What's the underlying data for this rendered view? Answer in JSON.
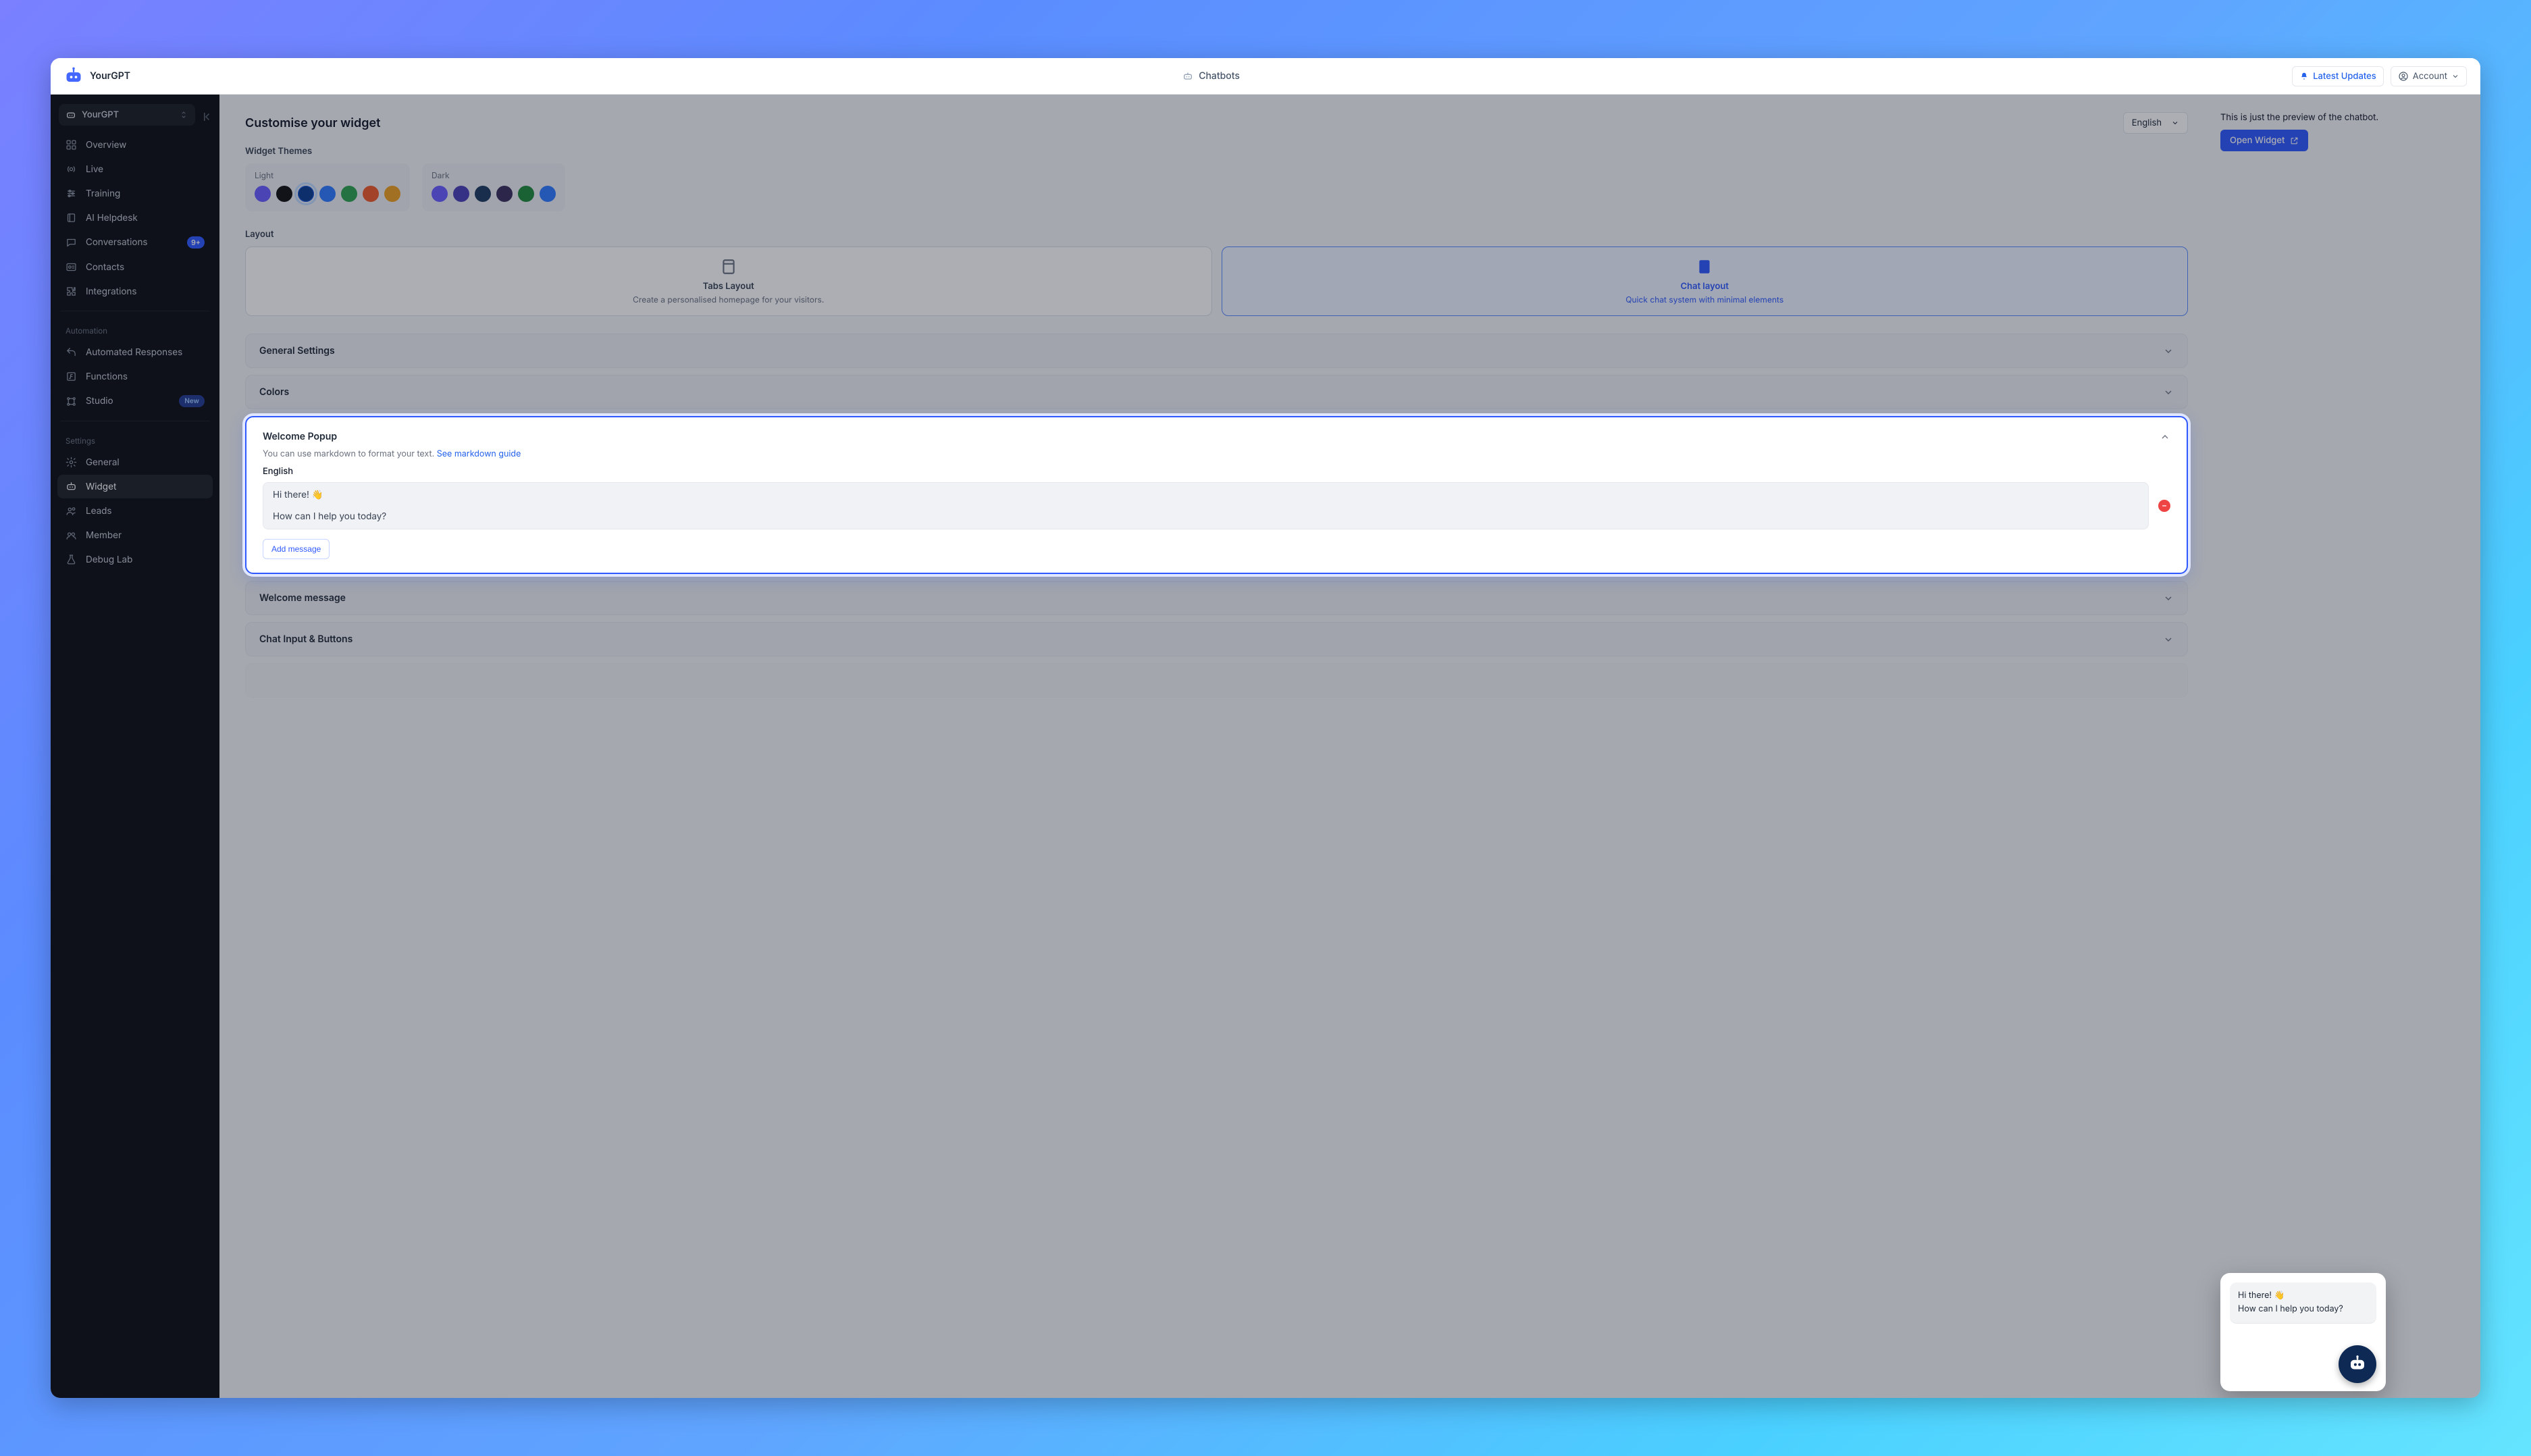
{
  "brand": {
    "name": "YourGPT"
  },
  "topbar": {
    "center": "Chatbots",
    "latest_updates": "Latest Updates",
    "account": "Account"
  },
  "sidebar": {
    "workspace": "YourGPT",
    "primary": [
      {
        "label": "Overview",
        "icon": "dashboard-icon"
      },
      {
        "label": "Live",
        "icon": "live-icon"
      },
      {
        "label": "Training",
        "icon": "sliders-icon"
      },
      {
        "label": "AI Helpdesk",
        "icon": "book-icon"
      },
      {
        "label": "Conversations",
        "icon": "chat-icon",
        "badge_count": "9+"
      },
      {
        "label": "Contacts",
        "icon": "user-card-icon"
      },
      {
        "label": "Integrations",
        "icon": "puzzle-icon"
      }
    ],
    "section_automation": "Automation",
    "automation": [
      {
        "label": "Automated Responses",
        "icon": "reply-icon"
      },
      {
        "label": "Functions",
        "icon": "function-icon"
      },
      {
        "label": "Studio",
        "icon": "studio-icon",
        "badge_new": "New"
      }
    ],
    "section_settings": "Settings",
    "settings": [
      {
        "label": "General",
        "icon": "gear-icon"
      },
      {
        "label": "Widget",
        "icon": "bot-icon",
        "active": true
      },
      {
        "label": "Leads",
        "icon": "users-icon"
      },
      {
        "label": "Member",
        "icon": "members-icon"
      },
      {
        "label": "Debug Lab",
        "icon": "flask-icon"
      }
    ]
  },
  "page": {
    "title": "Customise your widget",
    "language": "English",
    "themes_label": "Widget Themes",
    "light_label": "Light",
    "dark_label": "Dark",
    "light_swatches": [
      "#6a5cff",
      "#111111",
      "#0b3d91",
      "#2f7cff",
      "#2ea44f",
      "#ef5a2a",
      "#f0a020"
    ],
    "light_selected_index": 2,
    "dark_swatches": [
      "#6a5cff",
      "#4a3fb5",
      "#1e3a60",
      "#3a2f5c",
      "#1f8a3b",
      "#2f7cff"
    ],
    "layout_label": "Layout",
    "layout_tabs": {
      "title": "Tabs Layout",
      "desc": "Create a personalised homepage for your visitors."
    },
    "layout_chat": {
      "title": "Chat layout",
      "desc": "Quick chat system with minimal elements"
    },
    "accordions": {
      "general": "General Settings",
      "colors": "Colors",
      "welcome_popup": "Welcome Popup",
      "welcome_message": "Welcome message",
      "chat_input": "Chat Input & Buttons"
    },
    "welcome_popup": {
      "help": "You can use markdown to format your text. ",
      "help_link": "See markdown guide",
      "lang_label": "English",
      "message": "Hi there! 👋\n\nHow can I help you today?",
      "add_btn": "Add message"
    }
  },
  "preview": {
    "note": "This is just the preview of the chatbot.",
    "open_btn": "Open Widget"
  },
  "chat_card": {
    "text": "Hi there! 👋\nHow can I help you today?"
  }
}
